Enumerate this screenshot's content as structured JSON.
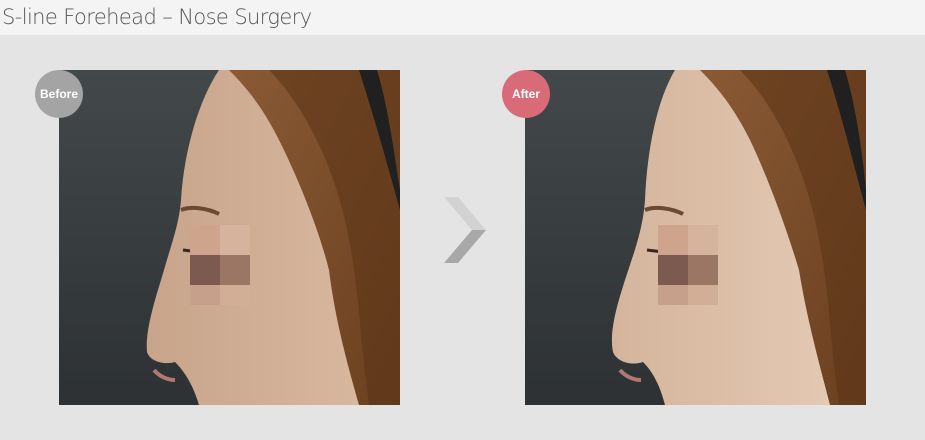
{
  "header": {
    "title": "S-line Forehead – Nose Surgery"
  },
  "panels": [
    {
      "badge": "Before",
      "badge_color": "#a4a4a4"
    },
    {
      "badge": "After",
      "badge_color": "#d96b78"
    }
  ],
  "icons": {
    "arrow": "chevron-right-icon"
  }
}
